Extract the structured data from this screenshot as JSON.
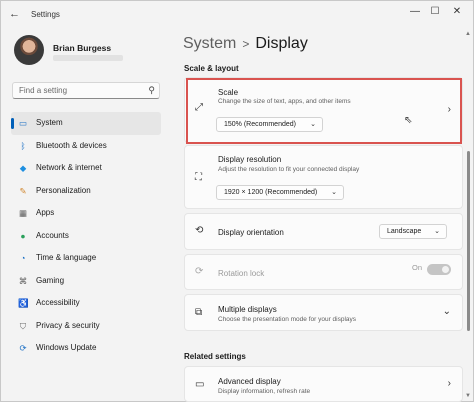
{
  "window": {
    "title": "Settings",
    "back_icon": "arrow-left",
    "minimize": "—",
    "maximize": "☐",
    "close": "✕"
  },
  "user": {
    "name": "Brian Burgess"
  },
  "search": {
    "placeholder": "Find a setting"
  },
  "nav": [
    {
      "label": "System",
      "icon": "monitor",
      "glyph": "▭",
      "color": "#1b6fc4",
      "active": true
    },
    {
      "label": "Bluetooth & devices",
      "icon": "bluetooth",
      "glyph": "ᛒ",
      "color": "#1b6fc4"
    },
    {
      "label": "Network & internet",
      "icon": "wifi",
      "glyph": "◆",
      "color": "#1e8fe0"
    },
    {
      "label": "Personalization",
      "icon": "brush",
      "glyph": "✎",
      "color": "#d0842a"
    },
    {
      "label": "Apps",
      "icon": "apps",
      "glyph": "▦",
      "color": "#5b5b5b"
    },
    {
      "label": "Accounts",
      "icon": "person",
      "glyph": "●",
      "color": "#2aa05b"
    },
    {
      "label": "Time & language",
      "icon": "globe",
      "glyph": "◔",
      "color": "#1b6fc4"
    },
    {
      "label": "Gaming",
      "icon": "gamepad",
      "glyph": "⌘",
      "color": "#5b5b5b"
    },
    {
      "label": "Accessibility",
      "icon": "accessibility",
      "glyph": "♿",
      "color": "#1b6fc4"
    },
    {
      "label": "Privacy & security",
      "icon": "shield",
      "glyph": "⛉",
      "color": "#6b6b6b"
    },
    {
      "label": "Windows Update",
      "icon": "update",
      "glyph": "⟳",
      "color": "#1b6fc4"
    }
  ],
  "breadcrumb": {
    "parent": "System",
    "separator": ">",
    "current": "Display"
  },
  "section_scale": "Scale & layout",
  "scale": {
    "title": "Scale",
    "subtitle": "Change the size of text, apps, and other items",
    "value": "150% (Recommended)"
  },
  "resolution": {
    "title": "Display resolution",
    "subtitle": "Adjust the resolution to fit your connected display",
    "value": "1920 × 1200 (Recommended)"
  },
  "orientation": {
    "title": "Display orientation",
    "value": "Landscape"
  },
  "rotation": {
    "title": "Rotation lock",
    "state": "On"
  },
  "multiple": {
    "title": "Multiple displays",
    "subtitle": "Choose the presentation mode for your displays"
  },
  "section_related": "Related settings",
  "advanced": {
    "title": "Advanced display",
    "subtitle": "Display information, refresh rate"
  }
}
